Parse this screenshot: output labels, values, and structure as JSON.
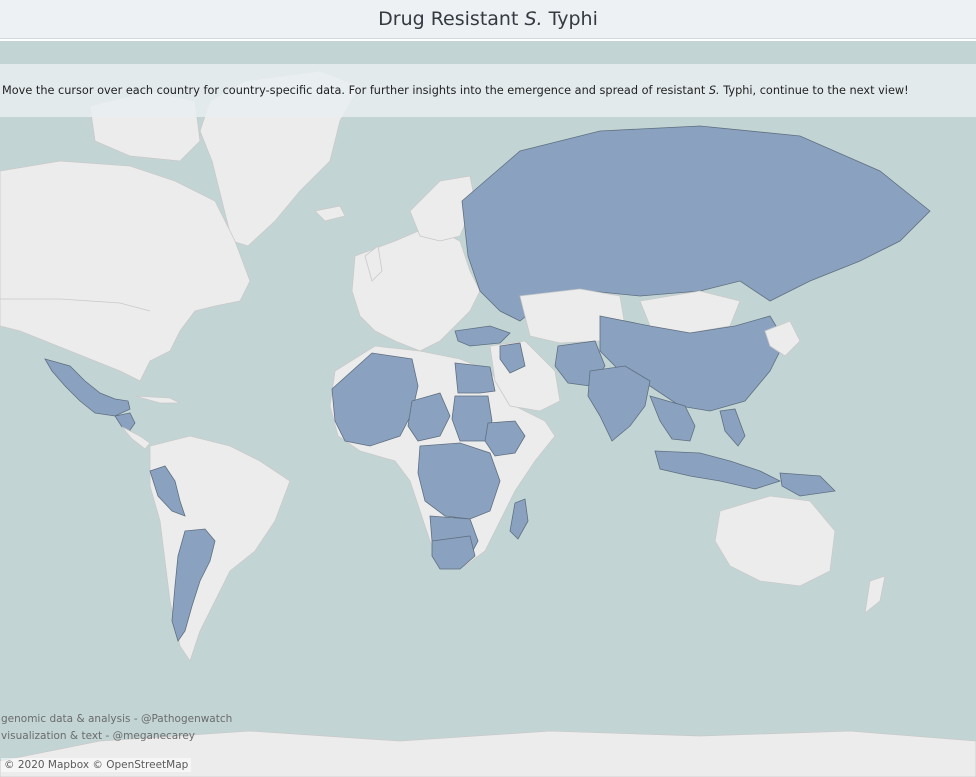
{
  "header": {
    "title_before": "Drug Resistant ",
    "title_italic": "S.",
    "title_after": " Typhi"
  },
  "instructions": {
    "text_before": "Move the cursor over each country for country-specific data. For further insights into the emergence and spread of resistant ",
    "text_italic": "S.",
    "text_after": " Typhi, continue to the next view!"
  },
  "credits": {
    "line1": "genomic data & analysis - @Pathogenwatch",
    "line2": "visualization & text - @meganecarey"
  },
  "attribution": "© 2020 Mapbox  © OpenStreetMap",
  "map": {
    "ocean_color": "#c2d5d4",
    "land_color": "#ececec",
    "resistant_color": "#8aa2c0",
    "resistant_regions": [
      "Mexico",
      "Central America",
      "Peru",
      "Argentina",
      "West Africa",
      "Nigeria",
      "Chad",
      "Egypt",
      "Sudan",
      "Ethiopia",
      "Central Africa",
      "East Africa",
      "Southern Africa",
      "South Africa",
      "Madagascar",
      "Turkey",
      "Iraq",
      "Pakistan",
      "Afghanistan",
      "India",
      "Bangladesh",
      "Nepal",
      "Russia",
      "China",
      "Southeast Asia",
      "Indonesia",
      "Papua New Guinea"
    ]
  }
}
